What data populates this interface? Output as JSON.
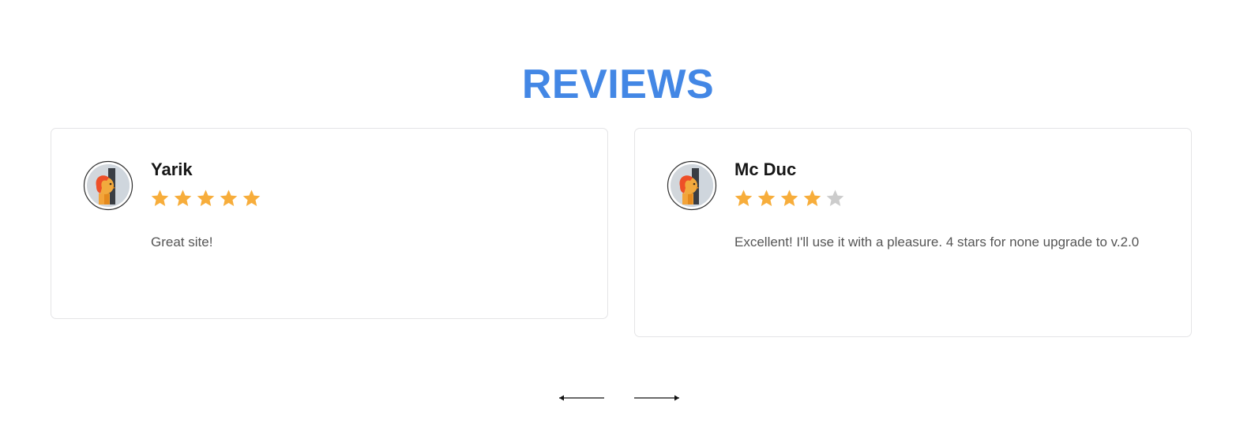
{
  "section": {
    "title": "REVIEWS"
  },
  "reviews": [
    {
      "name": "Yarik",
      "rating": 5,
      "max_rating": 5,
      "text": "Great site!",
      "avatar_icon": "user-avatar-icon"
    },
    {
      "name": "Mc Duc",
      "rating": 4,
      "max_rating": 5,
      "text": "Excellent! I'll use it with a pleasure. 4 stars for none upgrade to v.2.0",
      "avatar_icon": "user-avatar-icon"
    }
  ],
  "navigation": {
    "prev_icon": "arrow-left-icon",
    "next_icon": "arrow-right-icon"
  },
  "colors": {
    "title": "#4387e5",
    "star_filled": "#f7ad3b",
    "star_empty": "#cccccc",
    "card_border": "#e4e4e6",
    "text": "#555555"
  }
}
